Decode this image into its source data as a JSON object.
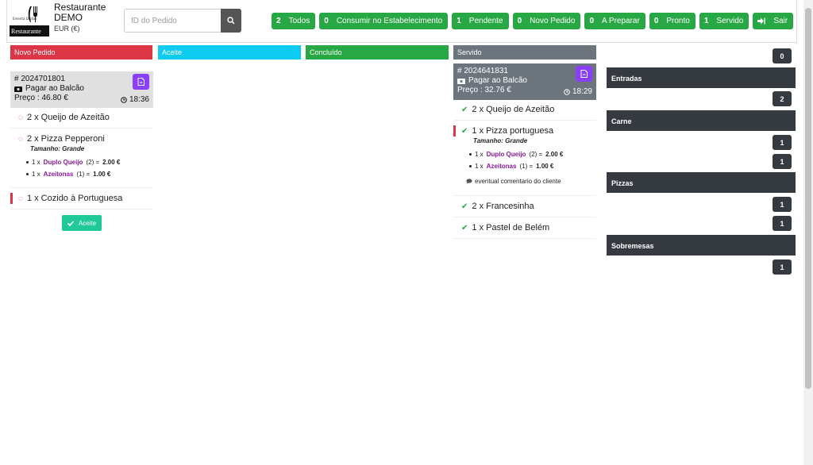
{
  "header": {
    "logo_text": "Restaurante",
    "brand_line1": "Restaurante",
    "brand_line2": "DEMO",
    "currency": "EUR (€)",
    "search_placeholder": "ID do Pedido"
  },
  "filters": [
    {
      "count": "2",
      "label": "Todos"
    },
    {
      "count": "0",
      "label": "Consumir no Estabelecimento"
    },
    {
      "count": "1",
      "label": "Pendente"
    },
    {
      "count": "0",
      "label": "Novo Pedido"
    },
    {
      "count": "0",
      "label": "A Preparar"
    },
    {
      "count": "0",
      "label": "Pronto"
    },
    {
      "count": "1",
      "label": "Servido"
    }
  ],
  "exit_label": "Sair",
  "columns": {
    "novo": "Novo Pedido",
    "aceite": "Aceite",
    "concluido": "Concluído",
    "servido": "Servido"
  },
  "order1": {
    "id": "# 2024701801",
    "payment": "Pagar ao Balcão",
    "price": "Preço : 46.80 €",
    "time": "18:36",
    "items": [
      {
        "text": "2 x Queijo de Azeitão"
      },
      {
        "text": "2 x Pizza Pepperoni",
        "size": "Tamanho: Grande",
        "extras": [
          {
            "qty": "1 x",
            "name": "Duplo Queijo",
            "count": "(2) =",
            "price": "2.00 €"
          },
          {
            "qty": "1 x",
            "name": "Azeitonas",
            "count": "(1) =",
            "price": "1.00 €"
          }
        ]
      },
      {
        "text": "1 x Cozido à Portuguesa"
      }
    ],
    "accept_label": "Aceite"
  },
  "order2": {
    "id": "# 2024641831",
    "payment": "Pagar ao Balcão",
    "price": "Preço : 32.76 €",
    "time": "18:29",
    "items": [
      {
        "text": "2 x Queijo de Azeitão"
      },
      {
        "text": "1 x Pizza portuguesa",
        "size": "Tamanho: Grande",
        "extras": [
          {
            "qty": "1 x",
            "name": "Duplo Queijo",
            "count": "(2) =",
            "price": "2.00 €"
          },
          {
            "qty": "1 x",
            "name": "Azeitonas",
            "count": "(1) =",
            "price": "1.00 €"
          }
        ],
        "comment": "eventual comentario do cliente"
      },
      {
        "text": "2 x Francesinha"
      },
      {
        "text": "1 x Pastel de Belém"
      }
    ]
  },
  "summary": {
    "top_badge": "0",
    "categories": [
      {
        "name": "Entradas",
        "badges": [
          "2"
        ]
      },
      {
        "name": "Carne",
        "badges": [
          "1",
          "1"
        ]
      },
      {
        "name": "Pizzas",
        "badges": [
          "1",
          "1"
        ]
      },
      {
        "name": "Sobremesas",
        "badges": [
          "1"
        ]
      }
    ]
  },
  "colors": {
    "green": "#28a745",
    "red": "#dc3545",
    "cyan": "#0dcaf0",
    "gray": "#6c757d",
    "dark": "#343a40",
    "purple": "#8a3ffc",
    "teal": "#20c997"
  }
}
